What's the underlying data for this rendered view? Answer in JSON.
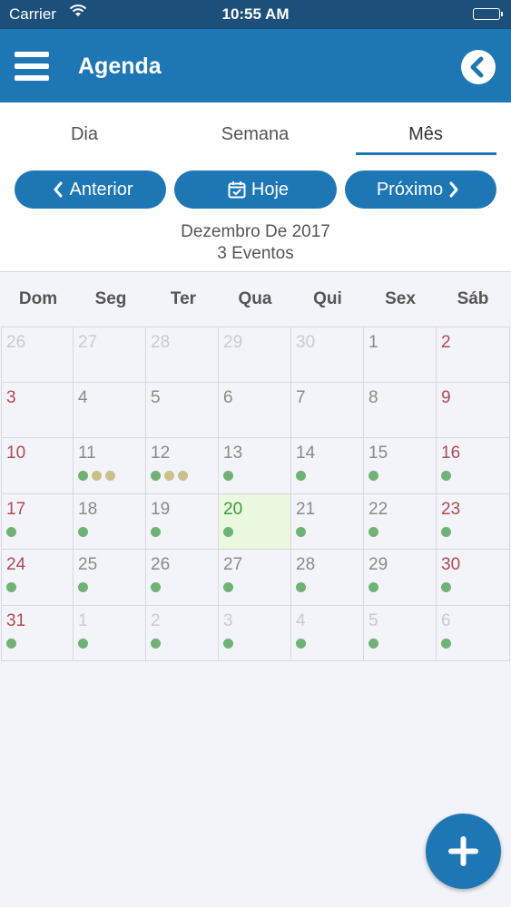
{
  "status_bar": {
    "carrier": "Carrier",
    "time": "10:55 AM"
  },
  "header": {
    "title": "Agenda"
  },
  "tabs": [
    {
      "label": "Dia"
    },
    {
      "label": "Semana"
    },
    {
      "label": "Mês"
    }
  ],
  "nav_buttons": {
    "previous": "Anterior",
    "today": "Hoje",
    "next": "Próximo"
  },
  "month": {
    "title": "Dezembro De 2017",
    "events": "3 Eventos"
  },
  "weekdays": [
    "Dom",
    "Seg",
    "Ter",
    "Qua",
    "Qui",
    "Sex",
    "Sáb"
  ],
  "colors": {
    "accent": "#1e77b5",
    "status_bar": "#1c4f79",
    "weekend_day": "#b04a55",
    "weekday": "#8a8a8a",
    "other_month": "#c9cbd0",
    "today_text": "#3a9d3a",
    "dot_green": "#6fb374",
    "dot_olive": "#c9c08a"
  },
  "calendar": {
    "days": [
      {
        "label": "26",
        "state": "other",
        "dots": []
      },
      {
        "label": "27",
        "state": "other",
        "dots": []
      },
      {
        "label": "28",
        "state": "other",
        "dots": []
      },
      {
        "label": "29",
        "state": "other",
        "dots": []
      },
      {
        "label": "30",
        "state": "other",
        "dots": []
      },
      {
        "label": "1",
        "state": "weekday",
        "dots": []
      },
      {
        "label": "2",
        "state": "weekend",
        "dots": []
      },
      {
        "label": "3",
        "state": "weekend",
        "dots": []
      },
      {
        "label": "4",
        "state": "weekday",
        "dots": []
      },
      {
        "label": "5",
        "state": "weekday",
        "dots": []
      },
      {
        "label": "6",
        "state": "weekday",
        "dots": []
      },
      {
        "label": "7",
        "state": "weekday",
        "dots": []
      },
      {
        "label": "8",
        "state": "weekday",
        "dots": []
      },
      {
        "label": "9",
        "state": "weekend",
        "dots": []
      },
      {
        "label": "10",
        "state": "weekend",
        "dots": []
      },
      {
        "label": "11",
        "state": "weekday",
        "dots": [
          "green",
          "olive",
          "olive"
        ]
      },
      {
        "label": "12",
        "state": "weekday",
        "dots": [
          "green",
          "olive",
          "olive"
        ]
      },
      {
        "label": "13",
        "state": "weekday",
        "dots": [
          "green"
        ]
      },
      {
        "label": "14",
        "state": "weekday",
        "dots": [
          "green"
        ]
      },
      {
        "label": "15",
        "state": "weekday",
        "dots": [
          "green"
        ]
      },
      {
        "label": "16",
        "state": "weekend",
        "dots": [
          "green"
        ]
      },
      {
        "label": "17",
        "state": "weekend",
        "dots": [
          "green"
        ]
      },
      {
        "label": "18",
        "state": "weekday",
        "dots": [
          "green"
        ]
      },
      {
        "label": "19",
        "state": "weekday",
        "dots": [
          "green"
        ]
      },
      {
        "label": "20",
        "state": "today",
        "dots": [
          "green"
        ]
      },
      {
        "label": "21",
        "state": "weekday",
        "dots": [
          "green"
        ]
      },
      {
        "label": "22",
        "state": "weekday",
        "dots": [
          "green"
        ]
      },
      {
        "label": "23",
        "state": "weekend",
        "dots": [
          "green"
        ]
      },
      {
        "label": "24",
        "state": "weekend",
        "dots": [
          "green"
        ]
      },
      {
        "label": "25",
        "state": "weekday",
        "dots": [
          "green"
        ]
      },
      {
        "label": "26",
        "state": "weekday",
        "dots": [
          "green"
        ]
      },
      {
        "label": "27",
        "state": "weekday",
        "dots": [
          "green"
        ]
      },
      {
        "label": "28",
        "state": "weekday",
        "dots": [
          "green"
        ]
      },
      {
        "label": "29",
        "state": "weekday",
        "dots": [
          "green"
        ]
      },
      {
        "label": "30",
        "state": "weekend",
        "dots": [
          "green"
        ]
      },
      {
        "label": "31",
        "state": "weekend",
        "dots": [
          "green"
        ]
      },
      {
        "label": "1",
        "state": "other",
        "dots": [
          "green"
        ]
      },
      {
        "label": "2",
        "state": "other",
        "dots": [
          "green"
        ]
      },
      {
        "label": "3",
        "state": "other",
        "dots": [
          "green"
        ]
      },
      {
        "label": "4",
        "state": "other",
        "dots": [
          "green"
        ]
      },
      {
        "label": "5",
        "state": "other",
        "dots": [
          "green"
        ]
      },
      {
        "label": "6",
        "state": "other",
        "dots": [
          "green"
        ]
      }
    ]
  }
}
